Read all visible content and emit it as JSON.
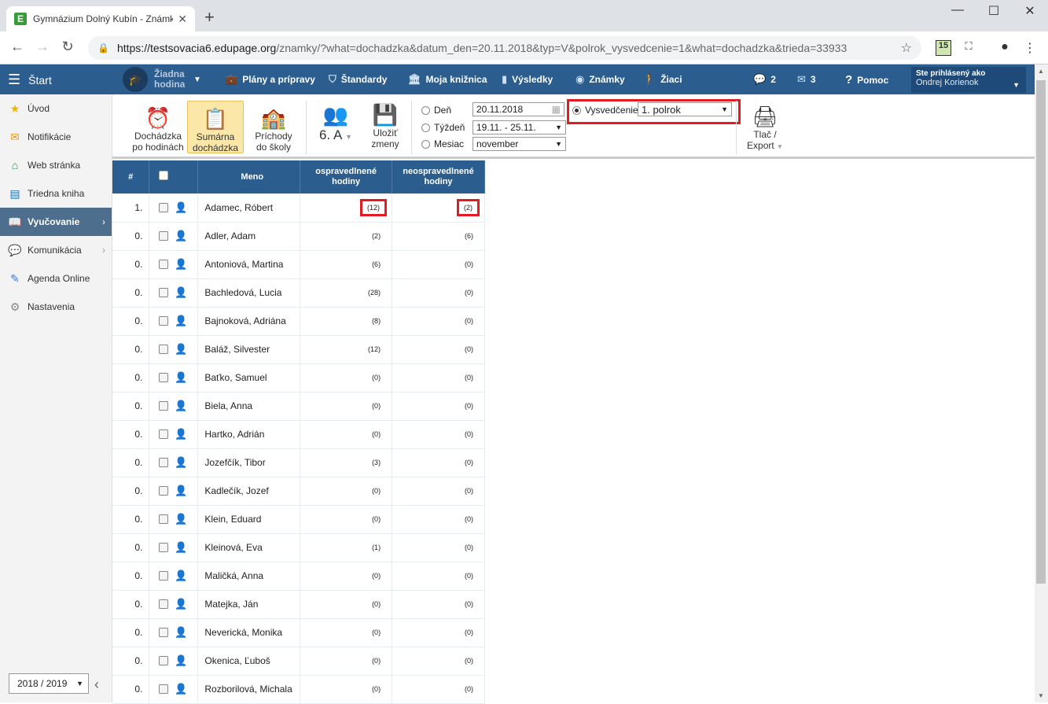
{
  "browser": {
    "tab_title": "Gymnázium Dolný Kubín - Známky",
    "favicon": "E",
    "url_host": "https://testsovacia6.edupage.org",
    "url_path": "/znamky/?what=dochadzka&datum_den=20.11.2018&typ=V&polrok_vysvedcenie=1&what=dochadzka&trieda=33933",
    "ext_badge": "15"
  },
  "header": {
    "start_label": "Štart",
    "hodina_label": "Žiadna hodina",
    "nav": [
      {
        "label": "Plány a prípravy",
        "icon": "briefcase-icon"
      },
      {
        "label": "Štandardy",
        "icon": "shield-icon"
      },
      {
        "label": "Moja knižnica",
        "icon": "library-icon"
      },
      {
        "label": "Výsledky",
        "icon": "bar-chart-icon"
      },
      {
        "label": "Známky",
        "icon": "grades-icon"
      },
      {
        "label": "Žiaci",
        "icon": "students-icon"
      }
    ],
    "messages_count": "2",
    "mail_count": "3",
    "help_label": "Pomoc",
    "user_label": "Ste prihlásený ako",
    "user_name": "Ondrej Korienok"
  },
  "sidebar": {
    "items": [
      {
        "label": "Úvod",
        "icon": "star-icon"
      },
      {
        "label": "Notifikácie",
        "icon": "envelope-icon"
      },
      {
        "label": "Web stránka",
        "icon": "home-icon"
      },
      {
        "label": "Triedna kniha",
        "icon": "book-icon"
      },
      {
        "label": "Vyučovanie",
        "icon": "open-book-icon"
      },
      {
        "label": "Komunikácia",
        "icon": "chat-icon"
      },
      {
        "label": "Agenda Online",
        "icon": "pen-icon"
      },
      {
        "label": "Nastavenia",
        "icon": "gear-icon"
      }
    ],
    "school_year": "2018 / 2019"
  },
  "toolbar": {
    "btn_hourly_1": "Dochádzka",
    "btn_hourly_2": "po hodinách",
    "btn_summary_1": "Sumárna",
    "btn_summary_2": "dochádzka",
    "btn_arrivals_1": "Príchody",
    "btn_arrivals_2": "do školy",
    "class_label": "6. A",
    "btn_save_1": "Uložiť",
    "btn_save_2": "zmeny",
    "radio_day": "Deň",
    "radio_week": "Týždeň",
    "radio_month": "Mesiac",
    "day_value": "20.11.2018",
    "week_value": "19.11. - 25.11.",
    "month_value": "november",
    "radio_report": "Vysvedčenie",
    "report_value": "1. polrok",
    "btn_print_1": "Tlač /",
    "btn_print_2": "Export"
  },
  "table": {
    "col_num": "#",
    "col_name": "Meno",
    "col_excused": "ospravedlnené hodiny",
    "col_unexcused": "neospravedlnené hodiny",
    "rows": [
      {
        "num": "1.",
        "name": "Adamec, Róbert",
        "excused": "(12)",
        "unexcused": "(2)",
        "gender": "m"
      },
      {
        "num": "0.",
        "name": "Adler, Adam",
        "excused": "(2)",
        "unexcused": "(6)",
        "gender": "m"
      },
      {
        "num": "0.",
        "name": "Antoniová, Martina",
        "excused": "(6)",
        "unexcused": "(0)",
        "gender": "f"
      },
      {
        "num": "0.",
        "name": "Bachledová, Lucia",
        "excused": "(28)",
        "unexcused": "(0)",
        "gender": "f"
      },
      {
        "num": "0.",
        "name": "Bajnoková, Adriána",
        "excused": "(8)",
        "unexcused": "(0)",
        "gender": "f"
      },
      {
        "num": "0.",
        "name": "Baláž, Silvester",
        "excused": "(12)",
        "unexcused": "(0)",
        "gender": "m"
      },
      {
        "num": "0.",
        "name": "Baťko, Samuel",
        "excused": "(0)",
        "unexcused": "(0)",
        "gender": "m"
      },
      {
        "num": "0.",
        "name": "Biela, Anna",
        "excused": "(0)",
        "unexcused": "(0)",
        "gender": "f"
      },
      {
        "num": "0.",
        "name": "Hartko, Adrián",
        "excused": "(0)",
        "unexcused": "(0)",
        "gender": "m"
      },
      {
        "num": "0.",
        "name": "Jozefčík, Tibor",
        "excused": "(3)",
        "unexcused": "(0)",
        "gender": "m"
      },
      {
        "num": "0.",
        "name": "Kadlečík, Jozef",
        "excused": "(0)",
        "unexcused": "(0)",
        "gender": "m"
      },
      {
        "num": "0.",
        "name": "Klein, Eduard",
        "excused": "(0)",
        "unexcused": "(0)",
        "gender": "m"
      },
      {
        "num": "0.",
        "name": "Kleinová, Eva",
        "excused": "(1)",
        "unexcused": "(0)",
        "gender": "f"
      },
      {
        "num": "0.",
        "name": "Maličká, Anna",
        "excused": "(0)",
        "unexcused": "(0)",
        "gender": "f"
      },
      {
        "num": "0.",
        "name": "Matejka, Ján",
        "excused": "(0)",
        "unexcused": "(0)",
        "gender": "m"
      },
      {
        "num": "0.",
        "name": "Neverická, Monika",
        "excused": "(0)",
        "unexcused": "(0)",
        "gender": "f"
      },
      {
        "num": "0.",
        "name": "Okenica, Ľuboš",
        "excused": "(0)",
        "unexcused": "(0)",
        "gender": "m"
      },
      {
        "num": "0.",
        "name": "Rozborilová, Michala",
        "excused": "(0)",
        "unexcused": "(0)",
        "gender": "f"
      }
    ]
  },
  "colors": {
    "header_blue": "#2b5d8f",
    "highlight_red": "#e31b23",
    "active_sidebar": "#4d6e8c"
  }
}
